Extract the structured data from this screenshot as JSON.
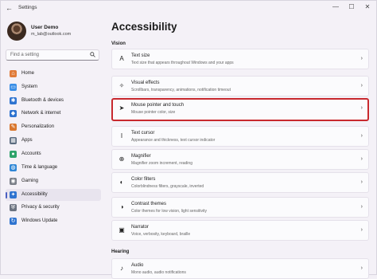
{
  "window": {
    "title": "Settings",
    "back_glyph": "←",
    "minimize": "—",
    "maximize": "☐",
    "close": "✕"
  },
  "profile": {
    "name": "User Demo",
    "email": "m_lab@outlook.com"
  },
  "search": {
    "placeholder": "Find a setting",
    "icon": "search-icon"
  },
  "nav": {
    "items": [
      {
        "label": "Home",
        "icon": "home-icon",
        "color": "#e07b39"
      },
      {
        "label": "System",
        "icon": "system-icon",
        "color": "#3a8ee6"
      },
      {
        "label": "Bluetooth & devices",
        "icon": "bluetooth-icon",
        "color": "#2f74d0"
      },
      {
        "label": "Network & internet",
        "icon": "network-icon",
        "color": "#2f74d0"
      },
      {
        "label": "Personalization",
        "icon": "brush-icon",
        "color": "#d9772e"
      },
      {
        "label": "Apps",
        "icon": "apps-icon",
        "color": "#5b6b7f"
      },
      {
        "label": "Accounts",
        "icon": "accounts-icon",
        "color": "#2ea36b"
      },
      {
        "label": "Time & language",
        "icon": "globe-icon",
        "color": "#2f86d6"
      },
      {
        "label": "Gaming",
        "icon": "gaming-icon",
        "color": "#7a7f88"
      },
      {
        "label": "Accessibility",
        "icon": "accessibility-icon",
        "color": "#2f74d0",
        "active": true
      },
      {
        "label": "Privacy & security",
        "icon": "shield-icon",
        "color": "#6b7280"
      },
      {
        "label": "Windows Update",
        "icon": "update-icon",
        "color": "#2f74d0"
      }
    ]
  },
  "main": {
    "title": "Accessibility",
    "sections": [
      {
        "label": "Vision"
      },
      {
        "label": "Hearing"
      }
    ],
    "cards": [
      {
        "title": "Text size",
        "subtitle": "Text size that appears throughout Windows and your apps",
        "icon": "text-size-icon"
      },
      {
        "title": "Visual effects",
        "subtitle": "Scrollbars, transparency, animations, notification timeout",
        "icon": "visual-effects-icon"
      },
      {
        "title": "Mouse pointer and touch",
        "subtitle": "Mouse pointer color, size",
        "icon": "mouse-pointer-icon",
        "highlighted": true
      },
      {
        "title": "Text cursor",
        "subtitle": "Appearance and thickness, text cursor indicator",
        "icon": "text-cursor-icon"
      },
      {
        "title": "Magnifier",
        "subtitle": "Magnifier zoom increment, reading",
        "icon": "magnifier-icon"
      },
      {
        "title": "Color filters",
        "subtitle": "Colorblindness filters, grayscale, inverted",
        "icon": "color-filters-icon"
      },
      {
        "title": "Contrast themes",
        "subtitle": "Color themes for low vision, light sensitivity",
        "icon": "contrast-icon"
      },
      {
        "title": "Narrator",
        "subtitle": "Voice, verbosity, keyboard, braille",
        "icon": "narrator-icon"
      },
      {
        "title": "Audio",
        "subtitle": "Mono audio, audio notifications",
        "icon": "audio-icon"
      }
    ],
    "chevron": "›"
  }
}
